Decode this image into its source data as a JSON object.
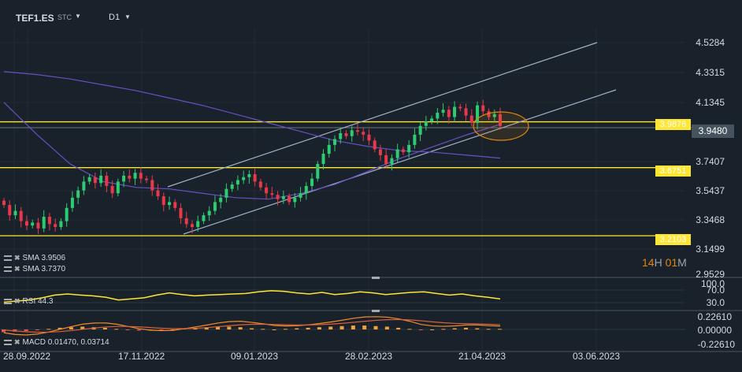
{
  "header": {
    "symbol": "TEF1.ES",
    "type": "STC",
    "timeframe": "D1"
  },
  "price_axis": [
    "4.5284",
    "4.3315",
    "4.1345",
    "3.9480",
    "3.7407",
    "3.5437",
    "3.3468",
    "3.1499",
    "2.9529"
  ],
  "rsi_axis": [
    "100.0",
    "70.0",
    "30.0"
  ],
  "macd_axis": [
    "0.22610",
    "0.00000",
    "-0.22610"
  ],
  "dates": [
    "28.09.2022",
    "17.11.2022",
    "09.01.2023",
    "28.02.2023",
    "21.04.2023",
    "03.06.2023"
  ],
  "current_price": "3.9480",
  "levels": [
    {
      "label": "3.9876",
      "value": 3.9876
    },
    {
      "label": "3.6751",
      "value": 3.6751
    },
    {
      "label": "3.2103",
      "value": 3.2103
    }
  ],
  "indicators": {
    "sma1": "SMA  3.9506",
    "sma2": "SMA  3.7370",
    "rsi": "RSI  44.3",
    "macd": "MACD  0.01470,  0.03714"
  },
  "timer": {
    "h": "14",
    "hl": "H",
    "m": "01",
    "ml": "M"
  },
  "colors": {
    "up": "#2ecc71",
    "down": "#e8394a",
    "level": "#ffe635",
    "sma": "#6a4fc4",
    "rsi": "#ffe635",
    "macd": "#f28c28",
    "signal": "#d9603b"
  },
  "chart_data": {
    "type": "candlestick",
    "ylim": [
      2.9529,
      4.5284
    ],
    "closes": [
      3.42,
      3.35,
      3.38,
      3.31,
      3.28,
      3.3,
      3.26,
      3.34,
      3.29,
      3.27,
      3.31,
      3.4,
      3.47,
      3.52,
      3.58,
      3.61,
      3.57,
      3.62,
      3.55,
      3.5,
      3.58,
      3.62,
      3.6,
      3.64,
      3.6,
      3.59,
      3.52,
      3.48,
      3.42,
      3.44,
      3.4,
      3.33,
      3.29,
      3.27,
      3.31,
      3.35,
      3.38,
      3.44,
      3.47,
      3.53,
      3.56,
      3.59,
      3.61,
      3.63,
      3.58,
      3.54,
      3.5,
      3.49,
      3.46,
      3.48,
      3.44,
      3.47,
      3.5,
      3.55,
      3.6,
      3.7,
      3.77,
      3.83,
      3.87,
      3.91,
      3.89,
      3.93,
      3.92,
      3.9,
      3.86,
      3.8,
      3.76,
      3.7,
      3.74,
      3.8,
      3.78,
      3.83,
      3.9,
      3.96,
      3.99,
      4.01,
      4.05,
      4.07,
      4.02,
      4.09,
      4.08,
      4.03,
      3.98,
      4.1,
      4.06,
      4.02,
      4.04,
      3.96
    ],
    "sma_long": [
      4.33,
      4.31,
      4.28,
      4.24,
      4.2,
      4.15,
      4.1,
      4.04,
      3.98,
      3.92,
      3.86,
      3.82,
      3.79,
      3.78,
      3.76,
      3.74
    ],
    "sma_short": [
      4.12,
      3.9,
      3.7,
      3.58,
      3.54,
      3.53,
      3.5,
      3.47,
      3.46,
      3.5,
      3.56,
      3.65,
      3.74,
      3.82,
      3.9,
      3.97
    ],
    "rsi": [
      32,
      36,
      40,
      48,
      58,
      62,
      58,
      55,
      50,
      40,
      44,
      48,
      58,
      66,
      60,
      55,
      58,
      60,
      62,
      64,
      70,
      74,
      72,
      66,
      62,
      68,
      60,
      64,
      70,
      66,
      60,
      64,
      68,
      70,
      64,
      58,
      62,
      55,
      50,
      44
    ],
    "macd_hist": [
      -0.05,
      -0.04,
      -0.03,
      -0.01,
      0.01,
      0.03,
      0.04,
      0.05,
      0.04,
      0.03,
      0.01,
      -0.01,
      -0.02,
      -0.02,
      -0.01,
      0.0,
      0.02,
      0.03,
      0.04,
      0.05,
      0.05,
      0.04,
      0.02,
      0.01,
      0.0,
      0.01,
      0.02,
      0.03,
      0.04,
      0.05,
      0.06,
      0.07,
      0.07,
      0.06,
      0.05,
      0.03,
      0.01,
      -0.01,
      0.0,
      0.01,
      0.02,
      0.03,
      0.02,
      0.01,
      0.01
    ]
  }
}
